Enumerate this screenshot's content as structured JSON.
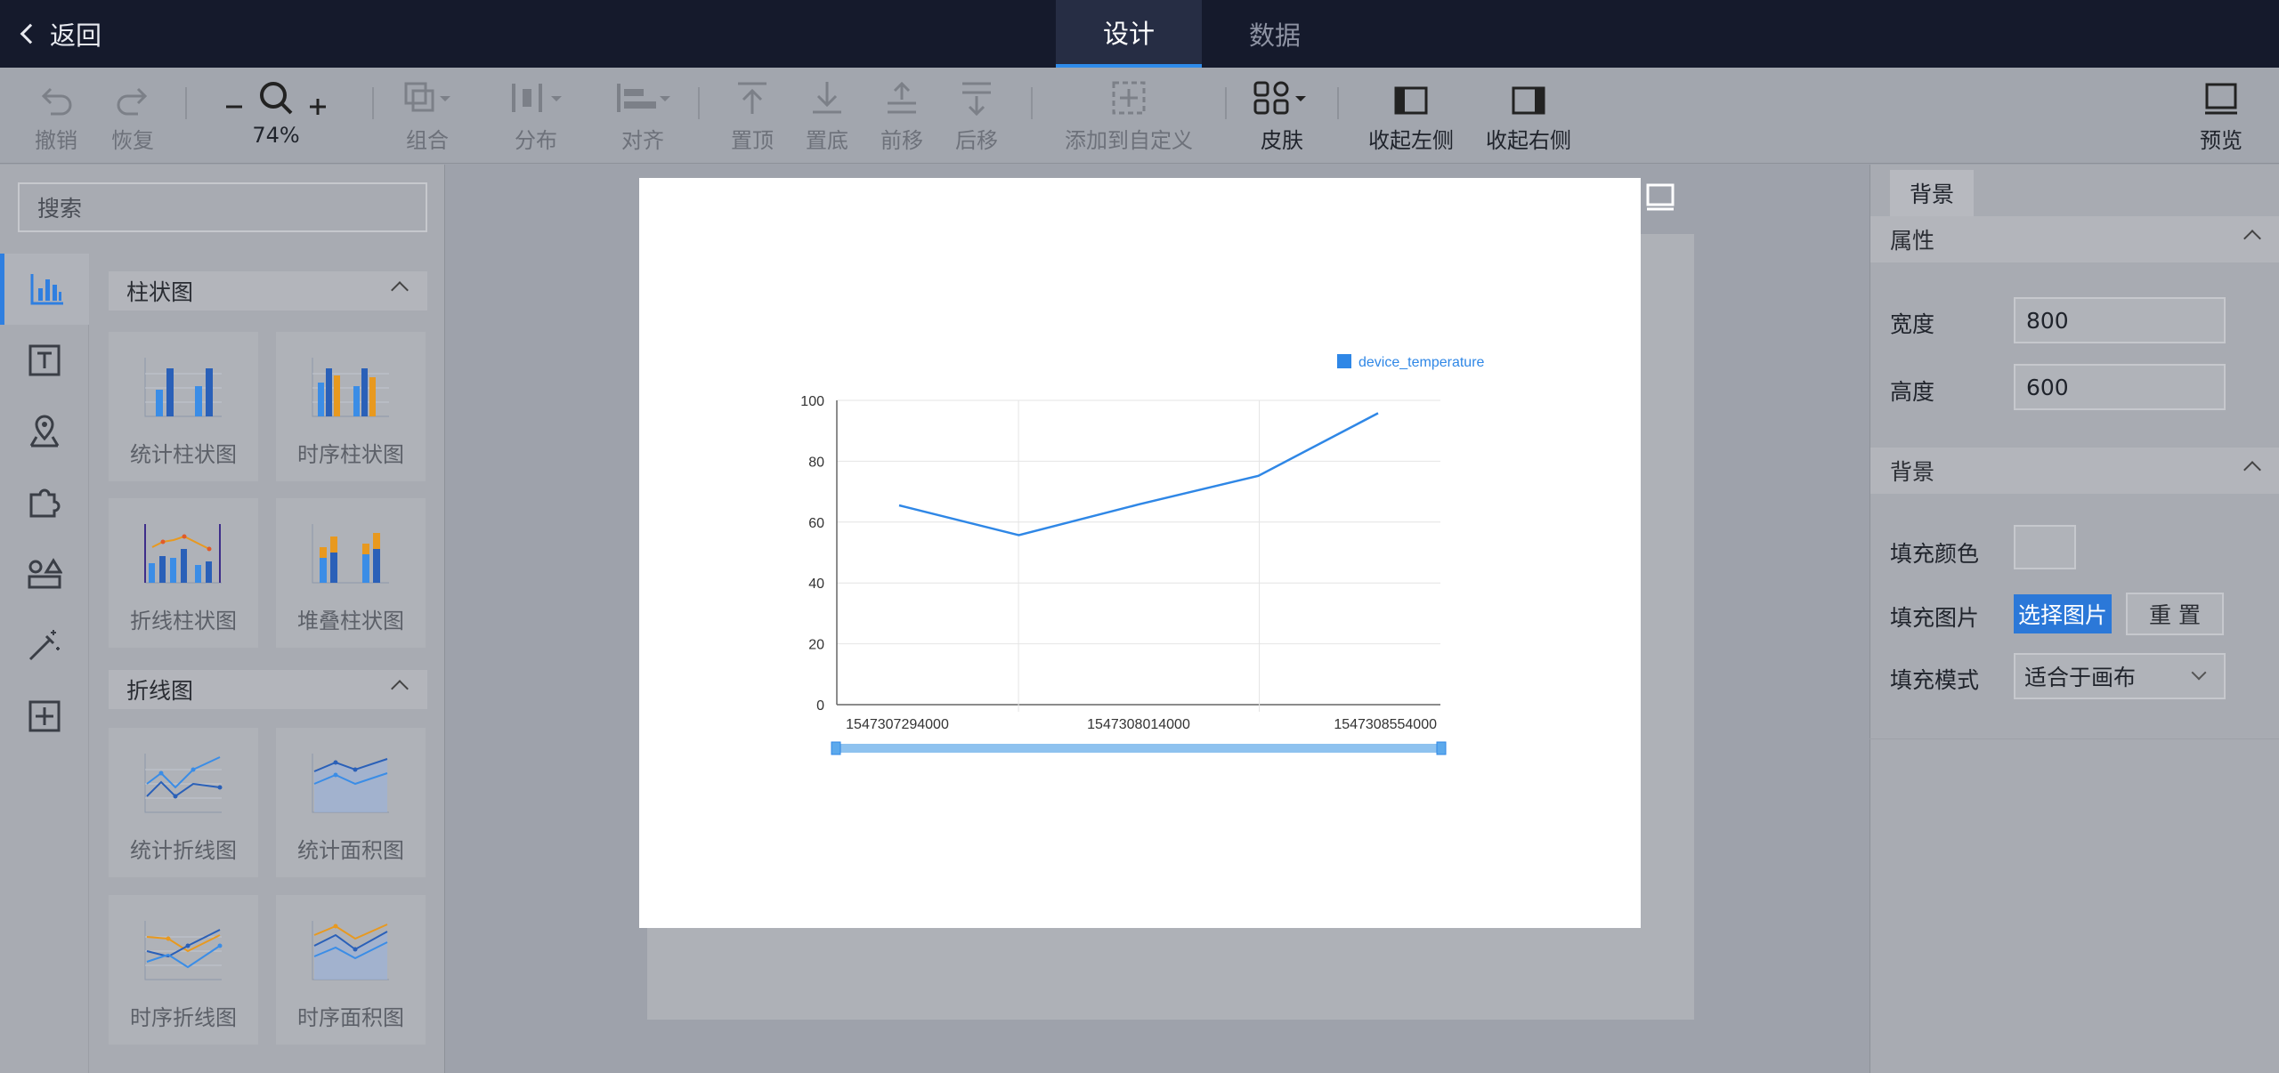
{
  "header": {
    "back_label": "返回",
    "tabs": [
      {
        "label": "设计",
        "active": true
      },
      {
        "label": "数据",
        "active": false
      }
    ]
  },
  "toolbar": {
    "undo": "撤销",
    "redo": "恢复",
    "zoom": "74%",
    "group": "组合",
    "distribute": "分布",
    "align": "对齐",
    "top": "置顶",
    "bottom": "置底",
    "forward": "前移",
    "backward": "后移",
    "add_custom": "添加到自定义",
    "skin": "皮肤",
    "collapse_left": "收起左侧",
    "collapse_right": "收起右侧",
    "preview": "预览"
  },
  "left_panel": {
    "search_placeholder": "搜索",
    "bar_section": "柱状图",
    "line_section": "折线图",
    "cards": {
      "stat_bar": "统计柱状图",
      "time_bar": "时序柱状图",
      "line_bar": "折线柱状图",
      "stack_bar": "堆叠柱状图",
      "stat_line": "统计折线图",
      "stat_area": "统计面积图",
      "time_line": "时序折线图",
      "time_area": "时序面积图"
    }
  },
  "right_panel": {
    "tab": "背景",
    "attr_section": "属性",
    "width_label": "宽度",
    "width_value": "800",
    "height_label": "高度",
    "height_value": "600",
    "bg_section": "背景",
    "fill_color_label": "填充颜色",
    "fill_image_label": "填充图片",
    "choose_image": "选择图片",
    "reset": "重 置",
    "fill_mode_label": "填充模式",
    "fill_mode_value": "适合于画布"
  },
  "colors": {
    "accent": "#2f8bea",
    "series": "#2f87e6",
    "topbar": "#151a2c"
  },
  "chart_data": {
    "type": "line",
    "x_ticks": [
      "1547307294000",
      "1547308014000",
      "1547308554000"
    ],
    "x": [
      0,
      1,
      2,
      3,
      4
    ],
    "series": [
      {
        "name": "device_temperature",
        "values": [
          65.5,
          55.7,
          65.8,
          75.2,
          95.8
        ]
      }
    ],
    "ylim": [
      0,
      100
    ],
    "y_ticks": [
      0,
      20,
      40,
      60,
      80,
      100
    ],
    "legend_position": "top-right",
    "grid": true
  }
}
